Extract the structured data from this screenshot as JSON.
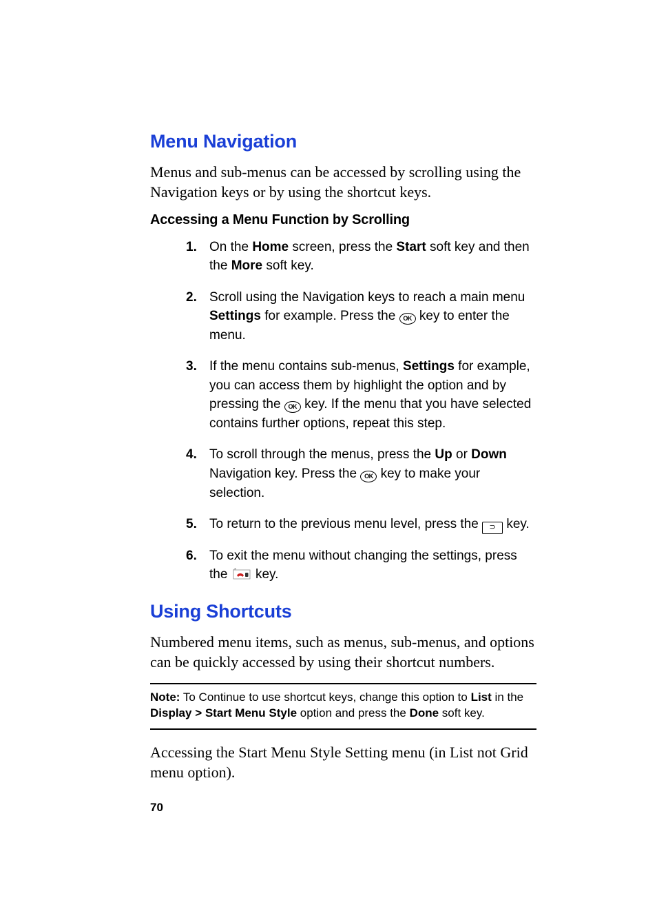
{
  "section1": {
    "title": "Menu Navigation",
    "intro": "Menus and sub-menus can be accessed by scrolling using the Navigation keys or by using the shortcut keys.",
    "subhead": "Accessing a Menu Function by Scrolling",
    "steps": [
      {
        "num": "1.",
        "pre": "On the ",
        "b1": "Home",
        "mid1": " screen, press the ",
        "b2": "Start",
        "mid2": " soft key and then the ",
        "b3": "More",
        "post": " soft key."
      },
      {
        "num": "2.",
        "pre": "Scroll using the Navigation keys to reach a main menu ",
        "b1": "Settings",
        "mid1": " for example. Press the ",
        "icon": "ok",
        "post": " key to enter the menu."
      },
      {
        "num": "3.",
        "pre": "If the menu contains sub-menus, ",
        "b1": "Settings",
        "mid1": " for example, you can access them by highlight the option and by pressing the ",
        "icon": "ok",
        "post": " key. If the menu that you have selected contains further options, repeat this step."
      },
      {
        "num": "4.",
        "pre": "To scroll through the menus, press the ",
        "b1": "Up",
        "mid1": " or ",
        "b2": "Down",
        "mid2": " Navigation key. Press the ",
        "icon": "ok",
        "post": " key to make your selection."
      },
      {
        "num": "5.",
        "pre": "To return to the previous menu level, press the ",
        "icon": "back",
        "post": " key."
      },
      {
        "num": "6.",
        "pre": "To exit the menu without changing the settings, press the ",
        "icon": "end",
        "post": " key."
      }
    ]
  },
  "section2": {
    "title": "Using Shortcuts",
    "intro": "Numbered menu items, such as menus, sub-menus, and options can be quickly accessed by using their shortcut numbers.",
    "note": {
      "label": "Note:",
      "t1": " To Continue to use shortcut keys, change this option to ",
      "b1": "List",
      "t2": " in the ",
      "b2": "Display > Start Menu Style",
      "t3": " option and press the ",
      "b3": "Done",
      "t4": " soft key."
    },
    "after": "Accessing the Start Menu Style Setting menu (in List not Grid menu option)."
  },
  "pagenum": "70"
}
